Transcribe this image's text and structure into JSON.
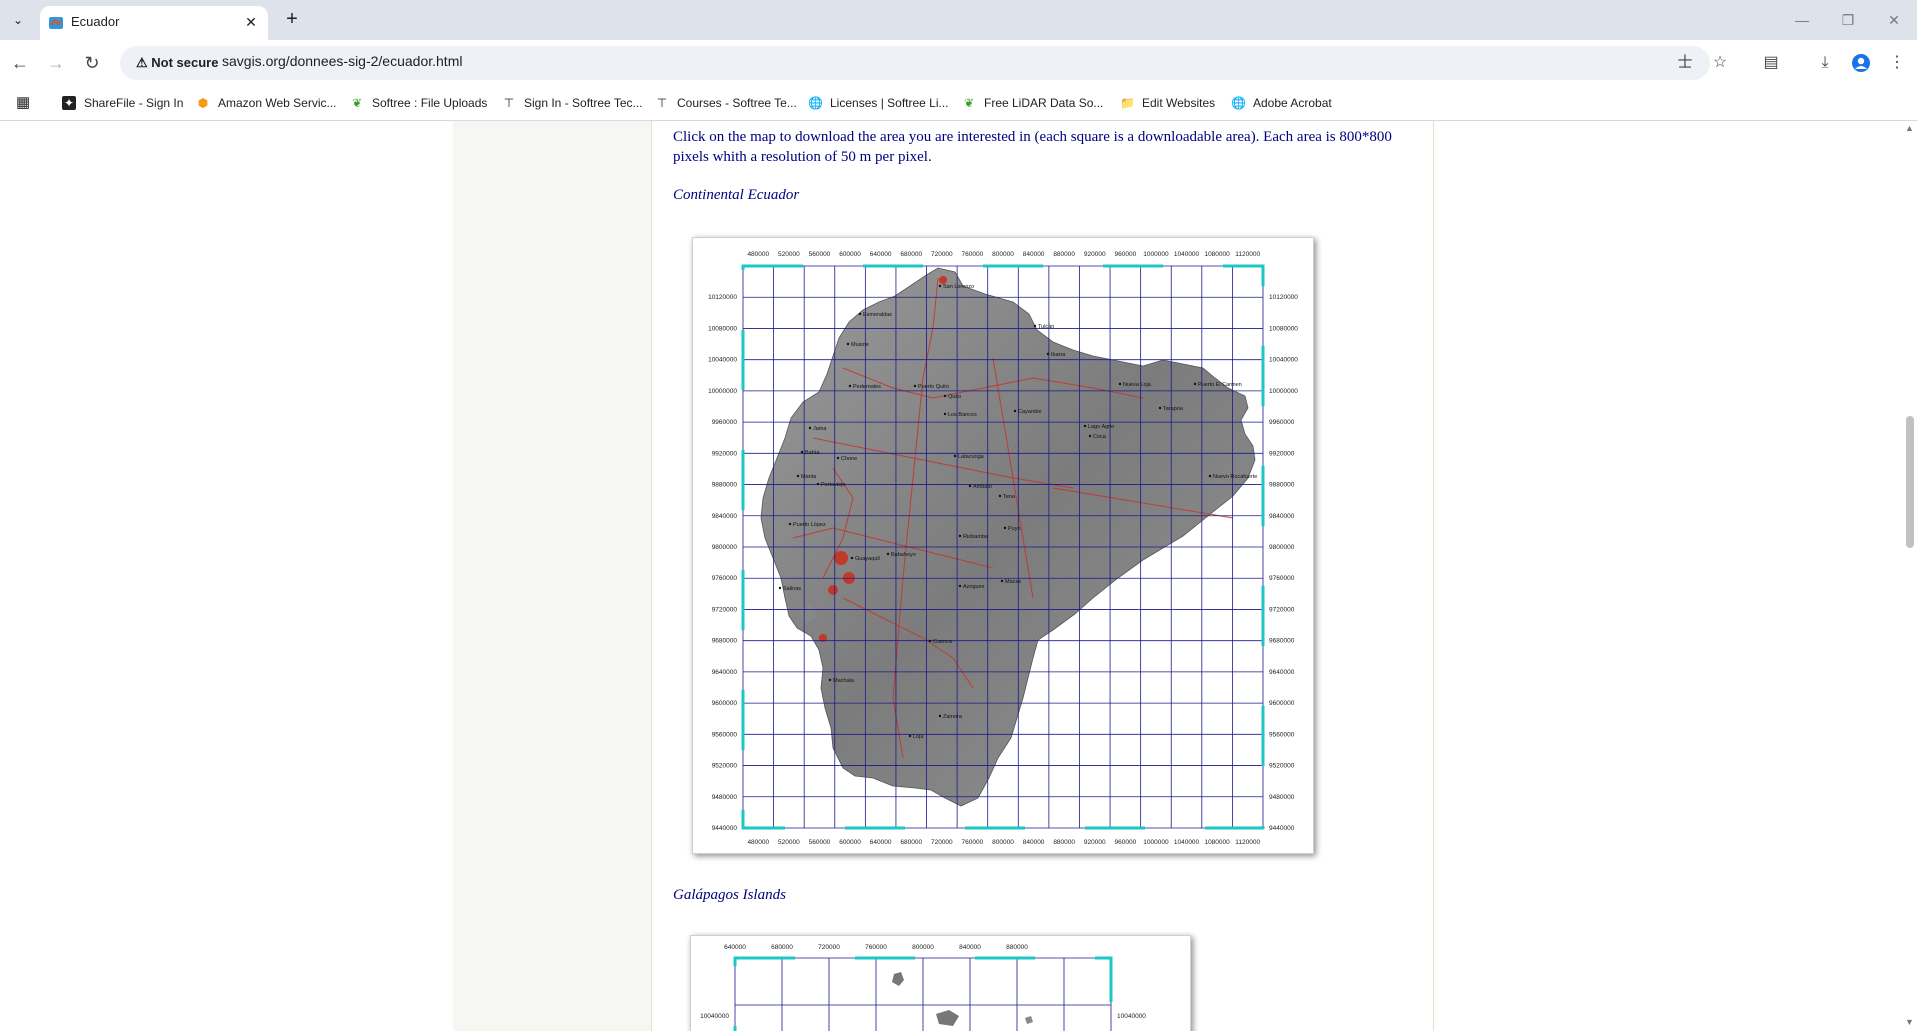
{
  "browser": {
    "tab_title": "Ecuador",
    "new_tab": "+",
    "close_tab": "✕",
    "security_label": "Not secure",
    "url": "savgis.org/donnees-sig-2/ecuador.html",
    "bookmarks": [
      {
        "label": "ShareFile - Sign In",
        "icon": "sharefile-icon"
      },
      {
        "label": "Amazon Web Servic...",
        "icon": "aws-icon"
      },
      {
        "label": "Softree : File Uploads",
        "icon": "softree-icon"
      },
      {
        "label": "Sign In - Softree Tec...",
        "icon": "softree-tec-icon"
      },
      {
        "label": "Courses - Softree Te...",
        "icon": "courses-icon"
      },
      {
        "label": "Licenses | Softree Li...",
        "icon": "licenses-icon"
      },
      {
        "label": "Free LiDAR Data So...",
        "icon": "lidar-icon"
      },
      {
        "label": "Edit Websites",
        "icon": "folder-icon"
      },
      {
        "label": "Adobe Acrobat",
        "icon": "acrobat-icon"
      }
    ]
  },
  "page": {
    "intro": "Click on the map to download the area you are interested in (each square is a downloadable area). Each area is 800*800 pixels whith a resolution of 50 m per pixel.",
    "continental_heading": "Continental Ecuador",
    "galapagos_heading": "Galápagos Islands",
    "continental_map": {
      "x_ticks": [
        "480000",
        "520000",
        "560000",
        "600000",
        "640000",
        "680000",
        "720000",
        "760000",
        "800000",
        "840000",
        "880000",
        "920000",
        "960000",
        "1000000",
        "1040000",
        "1080000",
        "1120000"
      ],
      "y_ticks": [
        "10120000",
        "10080000",
        "10040000",
        "10000000",
        "9960000",
        "9920000",
        "9880000",
        "9840000",
        "9800000",
        "9760000",
        "9720000",
        "9680000",
        "9640000",
        "9600000",
        "9560000",
        "9520000",
        "9480000",
        "9440000"
      ],
      "place_names": [
        "San Lorenzo",
        "Esmeraldas",
        "Muisne",
        "Tulcán",
        "Ibarra",
        "Pedernales",
        "Puerto Quito",
        "Quito",
        "Nueva Loja",
        "Puerto El Carmen",
        "Tarapoa",
        "Jama",
        "Los Bancos",
        "Cayambe",
        "Lago Agrio",
        "Nuevo Rocafuerte",
        "Bahía",
        "Chone",
        "Manta",
        "Portoviejo",
        "Puerto López",
        "Latacunga",
        "Ambato",
        "Riobamba",
        "Salinas",
        "Guayaquil",
        "Machala",
        "Cuenca",
        "Loja",
        "Macas",
        "Puyo",
        "Tena",
        "Zamora",
        "Coca",
        "Babahoyo",
        "Azogues"
      ]
    },
    "galapagos_map": {
      "x_ticks": [
        "640000",
        "680000",
        "720000",
        "760000",
        "800000",
        "840000",
        "880000"
      ],
      "y_ticks": [
        "10040000"
      ]
    }
  },
  "colors": {
    "link": "#000080",
    "grid": "#1a1a8c",
    "frame": "#1fc6c6",
    "land": "#8a8a8a",
    "roads": "#c0392b",
    "page_side": "#f6f6f2"
  }
}
